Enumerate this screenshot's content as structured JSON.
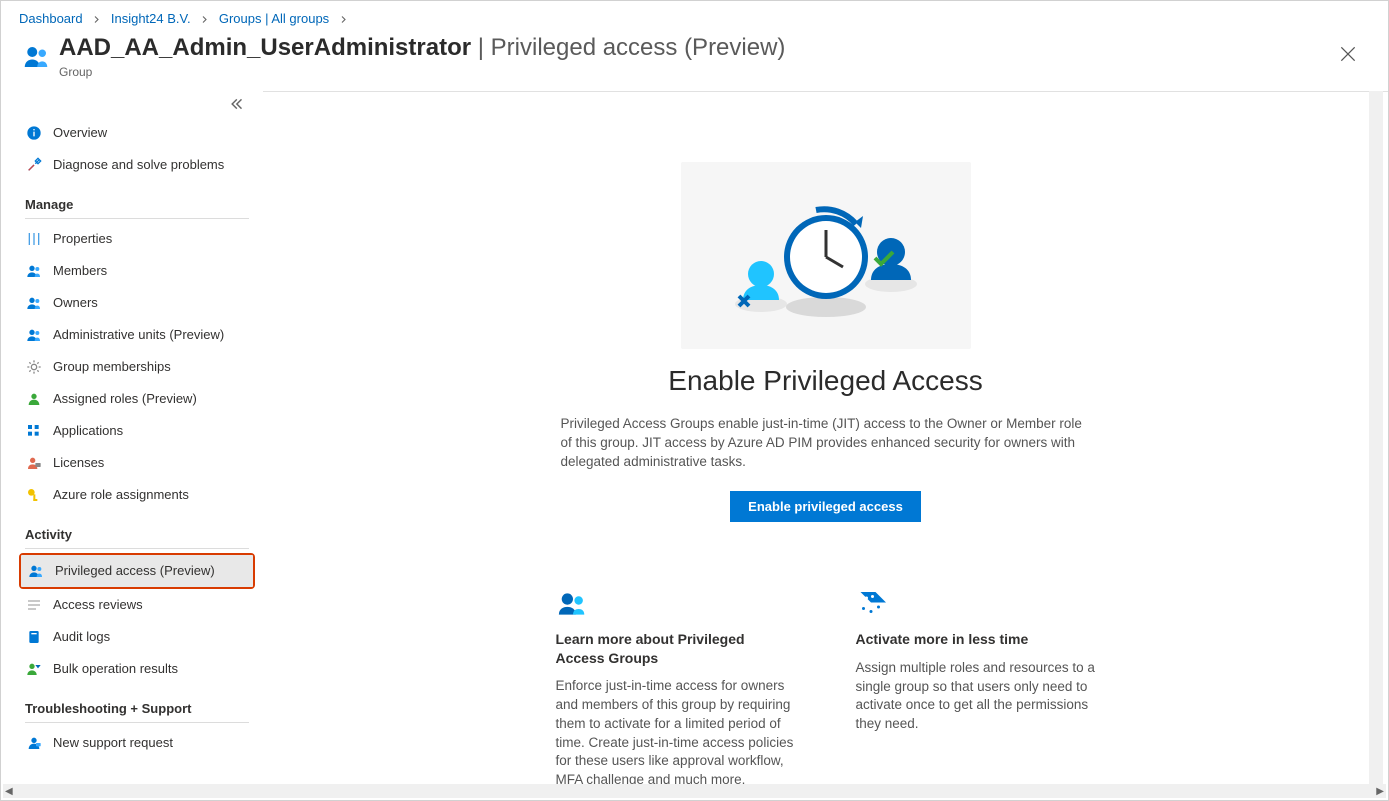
{
  "breadcrumb": [
    {
      "label": "Dashboard"
    },
    {
      "label": "Insight24 B.V."
    },
    {
      "label": "Groups | All groups"
    }
  ],
  "header": {
    "title_main": "AAD_AA_Admin_UserAdministrator",
    "title_suffix": " | Privileged access (Preview)",
    "subtitle": "Group"
  },
  "sidebar": {
    "top": [
      {
        "icon": "info-icon",
        "color": "#0078d4",
        "label": "Overview"
      },
      {
        "icon": "wrench-icon",
        "color": "#0078d4",
        "label": "Diagnose and solve problems"
      }
    ],
    "section_manage": "Manage",
    "manage_items": [
      {
        "icon": "sliders-icon",
        "color": "#4aa0e6",
        "label": "Properties"
      },
      {
        "icon": "people-icon",
        "color": "#0078d4",
        "label": "Members"
      },
      {
        "icon": "people-icon",
        "color": "#0078d4",
        "label": "Owners"
      },
      {
        "icon": "people-icon",
        "color": "#0078d4",
        "label": "Administrative units (Preview)"
      },
      {
        "icon": "gear-icon",
        "color": "#888888",
        "label": "Group memberships"
      },
      {
        "icon": "person-icon",
        "color": "#3aa83a",
        "label": "Assigned roles (Preview)"
      },
      {
        "icon": "grid-icon",
        "color": "#0078d4",
        "label": "Applications"
      },
      {
        "icon": "license-icon",
        "color": "#e06a50",
        "label": "Licenses"
      },
      {
        "icon": "key-icon",
        "color": "#f2c200",
        "label": "Azure role assignments"
      }
    ],
    "section_activity": "Activity",
    "activity_items": [
      {
        "icon": "people-icon",
        "color": "#0078d4",
        "label": "Privileged access (Preview)",
        "selected": true,
        "highlight": true
      },
      {
        "icon": "lines-icon",
        "color": "#aeaeae",
        "label": "Access reviews"
      },
      {
        "icon": "book-icon",
        "color": "#0078d4",
        "label": "Audit logs"
      },
      {
        "icon": "bulk-icon",
        "color": "#3aa83a",
        "label": "Bulk operation results"
      }
    ],
    "section_support": "Troubleshooting + Support",
    "support_items": [
      {
        "icon": "support-icon",
        "color": "#0078d4",
        "label": "New support request"
      }
    ]
  },
  "content": {
    "hero_title": "Enable Privileged Access",
    "hero_desc": "Privileged Access Groups enable just-in-time (JIT) access to the Owner or Member role of this group. JIT access by Azure AD PIM provides enhanced security for owners with delegated administrative tasks.",
    "primary_button": "Enable privileged access",
    "info": [
      {
        "icon": "people-info-icon",
        "title": "Learn more about Privileged Access Groups",
        "body": "Enforce just-in-time access for owners and members of this group by requiring them to activate for a limited period of time. Create just-in-time access policies for these users like approval workflow, MFA challenge and much more."
      },
      {
        "icon": "magic-info-icon",
        "title": "Activate more in less time",
        "body": "Assign multiple roles and resources to a single group so that users only need to activate once to get all the permissions they need."
      }
    ]
  }
}
